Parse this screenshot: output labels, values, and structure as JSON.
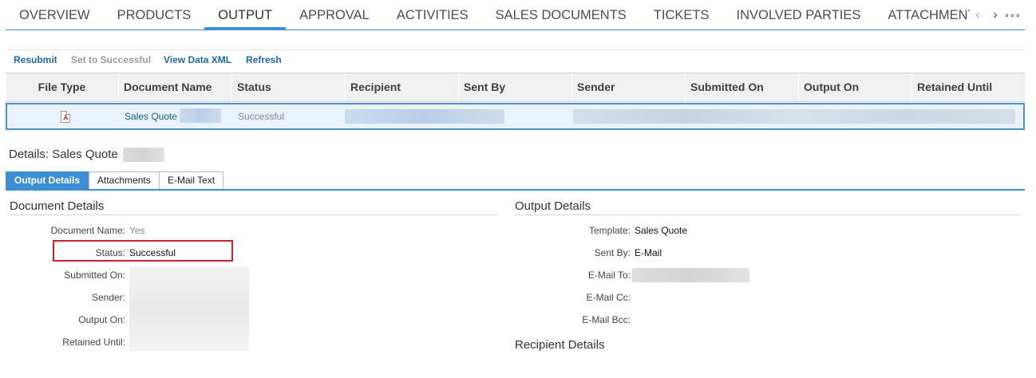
{
  "top_tabs": [
    "OVERVIEW",
    "PRODUCTS",
    "OUTPUT",
    "APPROVAL",
    "ACTIVITIES",
    "SALES DOCUMENTS",
    "TICKETS",
    "INVOLVED PARTIES",
    "ATTACHMENTS"
  ],
  "active_tab_index": 2,
  "nav": {
    "prev_glyph": "‹",
    "next_glyph": "›",
    "more_glyph": "∘∘∘"
  },
  "toolbar": {
    "resubmit": "Resubmit",
    "set_successful": "Set to Successful",
    "view_xml": "View Data XML",
    "refresh": "Refresh"
  },
  "table": {
    "columns": [
      "File Type",
      "Document Name",
      "Status",
      "Recipient",
      "Sent By",
      "Sender",
      "Submitted On",
      "Output On",
      "Retained Until"
    ],
    "row": {
      "file_type_icon": "pdf-icon",
      "document_name": "Sales Quote",
      "status": "Successful"
    }
  },
  "details": {
    "title": "Details: Sales Quote",
    "subtabs": [
      "Output Details",
      "Attachments",
      "E-Mail Text"
    ],
    "active_subtab_index": 0,
    "document_details": {
      "heading": "Document Details",
      "fields": [
        {
          "label": "Document Name:",
          "value": "Yes"
        },
        {
          "label": "Status:",
          "value": "Successful"
        },
        {
          "label": "Submitted On:",
          "value": ""
        },
        {
          "label": "Sender:",
          "value": ""
        },
        {
          "label": "Output On:",
          "value": ""
        },
        {
          "label": "Retained Until:",
          "value": ""
        }
      ]
    },
    "output_details": {
      "heading": "Output Details",
      "fields": [
        {
          "label": "Template:",
          "value": "Sales Quote"
        },
        {
          "label": "Sent By:",
          "value": "E-Mail"
        },
        {
          "label": "E-Mail To:",
          "value": ""
        },
        {
          "label": "E-Mail Cc:",
          "value": ""
        },
        {
          "label": "E-Mail Bcc:",
          "value": ""
        }
      ]
    },
    "recipient_details": {
      "heading": "Recipient Details"
    }
  },
  "colors": {
    "accent": "#3d8fd4",
    "link": "#1f6aa9",
    "highlight": "#d0202e"
  }
}
